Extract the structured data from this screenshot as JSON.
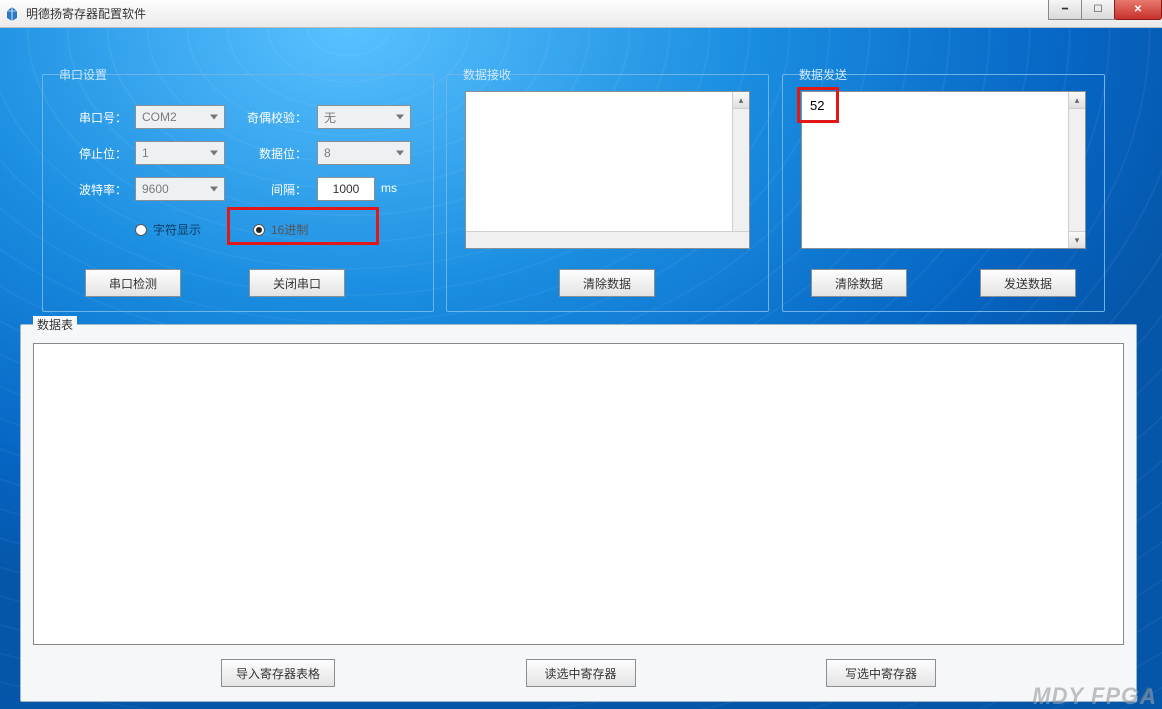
{
  "window": {
    "title": "明德扬寄存器配置软件"
  },
  "serial_group": {
    "title": "串口设置",
    "port_label": "串口号：",
    "port_value": "COM2",
    "stop_label": "停止位：",
    "stop_value": "1",
    "baud_label": "波特率：",
    "baud_value": "9600",
    "parity_label": "奇偶校验：",
    "parity_value": "无",
    "data_label": "数据位：",
    "data_value": "8",
    "interval_label": "间隔：",
    "interval_value": "1000",
    "interval_unit": "ms",
    "radio_char_label": "字符显示",
    "radio_hex_label": "16进制",
    "detect_btn": "串口检测",
    "close_btn": "关闭串口"
  },
  "recv_group": {
    "title": "数据接收",
    "clear_btn": "清除数据",
    "content": ""
  },
  "send_group": {
    "title": "数据发送",
    "clear_btn": "清除数据",
    "send_btn": "发送数据",
    "content": "52"
  },
  "table_group": {
    "title": "数据表",
    "import_btn": "导入寄存器表格",
    "read_btn": "读选中寄存器",
    "write_btn": "写选中寄存器"
  },
  "watermark": "MDY FPGA"
}
